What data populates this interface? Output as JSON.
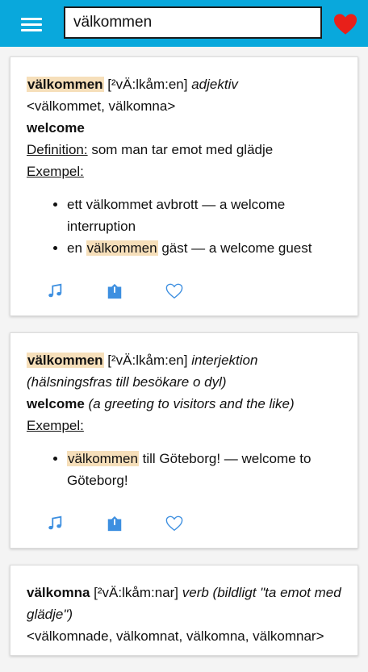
{
  "search": {
    "value": "välkommen"
  },
  "colors": {
    "header": "#09a8dc",
    "heart": "#e8201a",
    "highlight": "#f6dfba",
    "icon": "#3d8fe0"
  },
  "cards": [
    {
      "word": "välkommen",
      "pron": "[²vÄ:lkåm:en]",
      "pos": "adjektiv",
      "forms": "<välkommet, välkomna>",
      "translation": "welcome",
      "def_label": "Definition:",
      "def_text": "som man tar emot med glädje",
      "ex_label": "Exempel:",
      "examples": [
        {
          "text": "ett välkommet avbrott — a welcome interruption"
        },
        {
          "pre": "en",
          "hl": "välkommen",
          "post": "gäst — a welcome guest"
        }
      ],
      "actions": [
        "music-note-icon",
        "share-icon",
        "heart-outline-icon"
      ]
    },
    {
      "word": "välkommen",
      "pron": "[²vÄ:lkåm:en]",
      "pos": "interjektion",
      "pos_note": "(hälsningsfras till besökare o dyl)",
      "translation": "welcome",
      "translation_note": "(a greeting to visitors and the like)",
      "ex_label": "Exempel:",
      "examples": [
        {
          "hl": "välkommen",
          "post": "till Göteborg! — welcome to Göteborg!"
        }
      ],
      "actions": [
        "music-note-icon",
        "share-icon",
        "heart-outline-icon"
      ]
    },
    {
      "word": "välkomna",
      "pron": "[²vÄ:lkåm:nar]",
      "pos": "verb (bildligt \"ta emot med glädje\")",
      "forms": "<välkomnade, välkomnat, välkomna, välkomnar>"
    }
  ]
}
